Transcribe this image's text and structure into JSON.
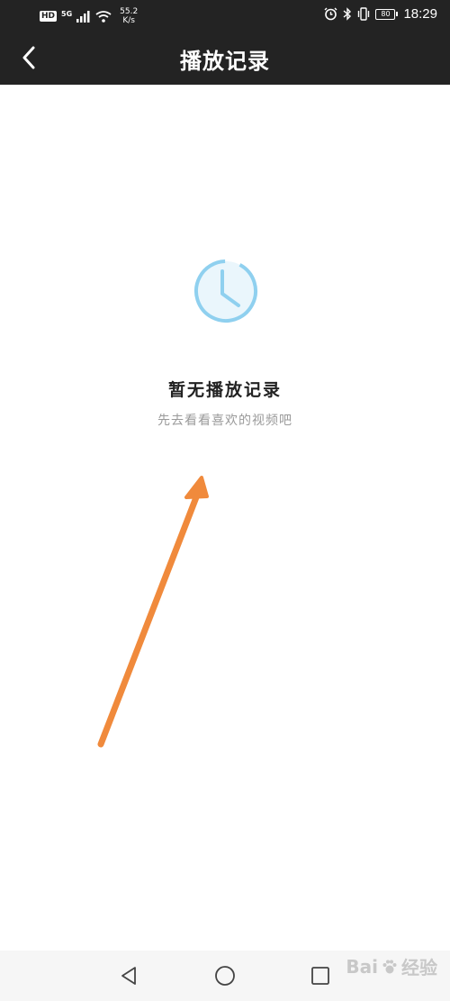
{
  "status_bar": {
    "hd_badge": "HD",
    "network_type": "5G",
    "speed_value": "55.2",
    "speed_unit": "K/s",
    "battery_level": "80",
    "time": "18:29"
  },
  "header": {
    "title": "播放记录",
    "back_icon": "chevron-left-icon"
  },
  "empty_state": {
    "icon": "clock-icon",
    "title": "暂无播放记录",
    "subtitle": "先去看看喜欢的视频吧"
  },
  "nav_bar": {
    "back_icon": "triangle-back-icon",
    "home_icon": "circle-home-icon",
    "recent_icon": "square-recent-icon"
  },
  "watermark": {
    "brand": "Bai",
    "brand_suffix": "经验"
  },
  "colors": {
    "header_bg": "#232323",
    "icon_blue": "#8fd0ef",
    "arrow_orange": "#f08a3c",
    "subtitle_gray": "#9a9a9a"
  }
}
